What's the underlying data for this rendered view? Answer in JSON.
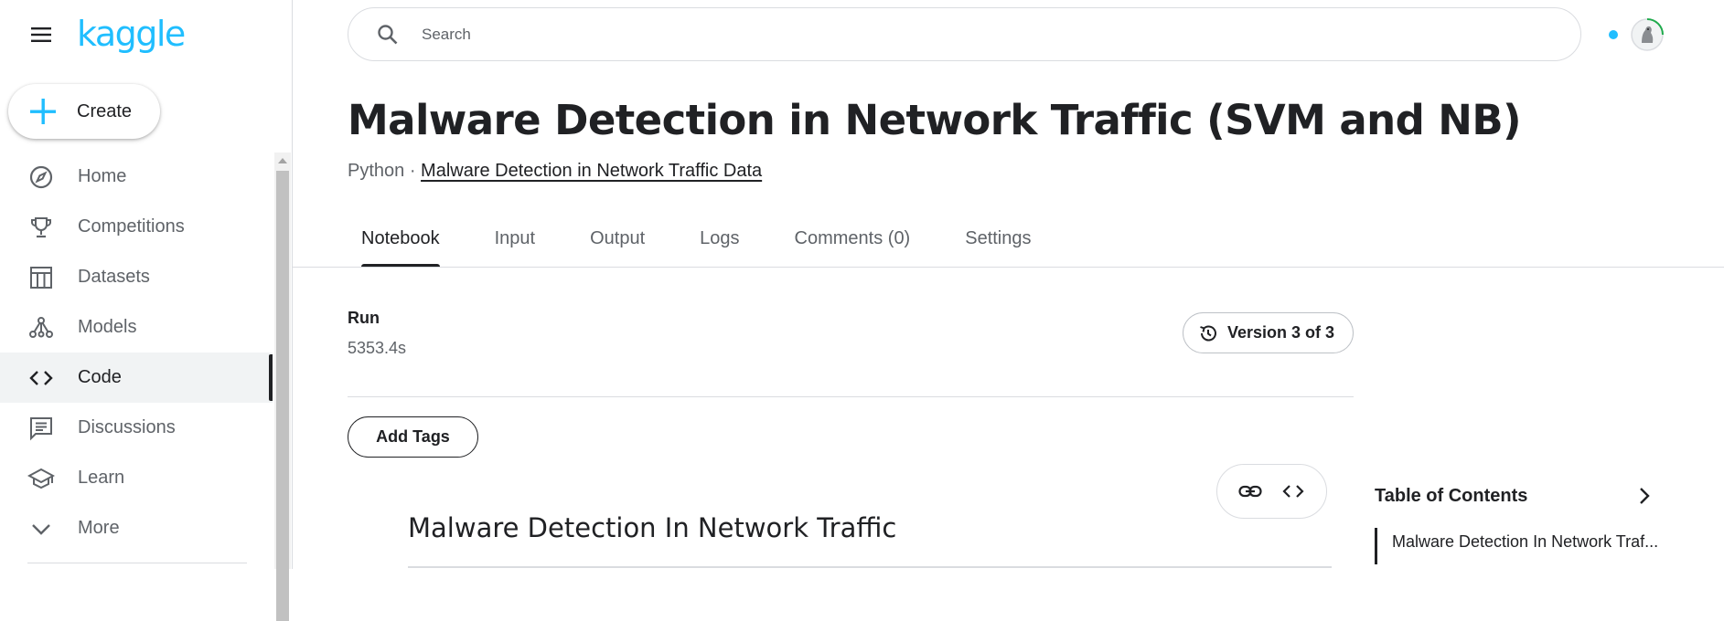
{
  "brand": {
    "logo_text": "kaggle",
    "accent_color": "#20beff"
  },
  "sidebar": {
    "create_label": "Create",
    "items": [
      {
        "label": "Home",
        "icon": "compass-icon",
        "active": false
      },
      {
        "label": "Competitions",
        "icon": "trophy-icon",
        "active": false
      },
      {
        "label": "Datasets",
        "icon": "table-icon",
        "active": false
      },
      {
        "label": "Models",
        "icon": "models-icon",
        "active": false
      },
      {
        "label": "Code",
        "icon": "code-icon",
        "active": true
      },
      {
        "label": "Discussions",
        "icon": "comment-icon",
        "active": false
      },
      {
        "label": "Learn",
        "icon": "school-icon",
        "active": false
      },
      {
        "label": "More",
        "icon": "chevron-down-icon",
        "active": false
      }
    ]
  },
  "header": {
    "search_placeholder": "Search"
  },
  "notebook": {
    "title": "Malware Detection in Network Traffic (SVM and NB)",
    "language": "Python",
    "separator": " · ",
    "dataset_link": "Malware Detection in Network Traffic Data",
    "tabs": [
      "Notebook",
      "Input",
      "Output",
      "Logs",
      "Comments (0)",
      "Settings"
    ],
    "active_tab": "Notebook",
    "run_label": "Run",
    "run_value": "5353.4s",
    "version_label": "Version 3 of 3",
    "add_tags_label": "Add Tags",
    "first_heading": "Malware Detection In Network Traffic"
  },
  "toc": {
    "title": "Table of Contents",
    "items": [
      "Malware Detection In Network Traf..."
    ]
  }
}
